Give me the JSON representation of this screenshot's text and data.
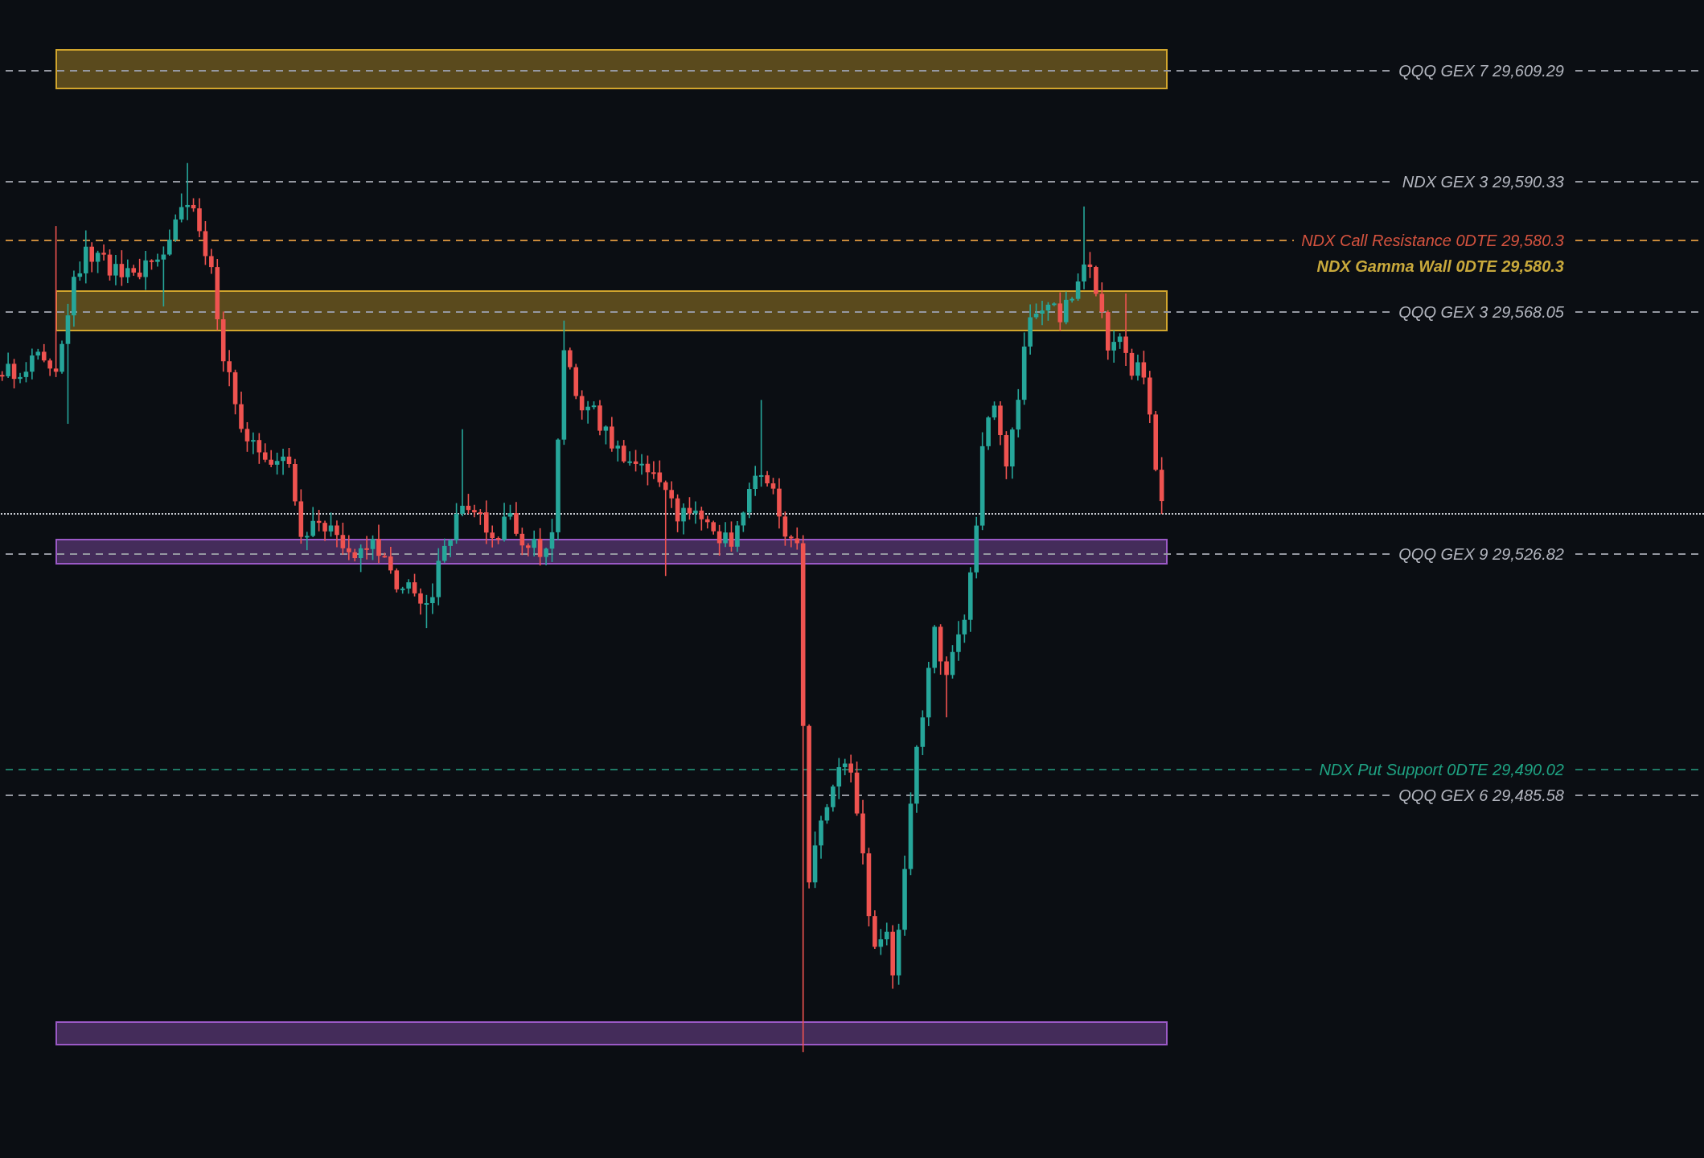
{
  "zones": [
    {
      "color": "#d1a52d"
    },
    {
      "color": "#d1a52d"
    },
    {
      "color": "#9b59c6"
    },
    {
      "color": "#9b59c6"
    }
  ],
  "levels": [
    {
      "kind": "line",
      "label": "QQQ GEX 7 29,609.29",
      "color": "#b2b5be",
      "line": {
        "color": "#9598a1"
      }
    },
    {
      "kind": "line",
      "label": "NDX GEX 3 29,590.33",
      "color": "#b2b5be",
      "line": {
        "color": "#9598a1"
      }
    },
    {
      "kind": "line",
      "label": "NDX Call Resistance 0DTE 29,580.3",
      "color": "#d6533f",
      "line": {
        "color": "#c98a3b"
      }
    },
    {
      "kind": "label",
      "label": "NDX Gamma Wall 0DTE 29,580.3",
      "color": "#c9a93c"
    },
    {
      "kind": "line",
      "label": "QQQ GEX 3 29,568.05",
      "color": "#b2b5be",
      "line": {
        "color": "#9598a1"
      }
    },
    {
      "kind": "line",
      "label": "QQQ GEX 9 29,526.82",
      "color": "#b2b5be",
      "line": {
        "color": "#9598a1"
      }
    },
    {
      "kind": "line",
      "label": "NDX Put Support 0DTE 29,490.02",
      "color": "#1fa383",
      "line": {
        "color": "#1f7a66"
      }
    },
    {
      "kind": "line",
      "label": "QQQ GEX 6 29,485.58",
      "color": "#b2b5be",
      "line": {
        "color": "#9598a1"
      }
    }
  ]
}
